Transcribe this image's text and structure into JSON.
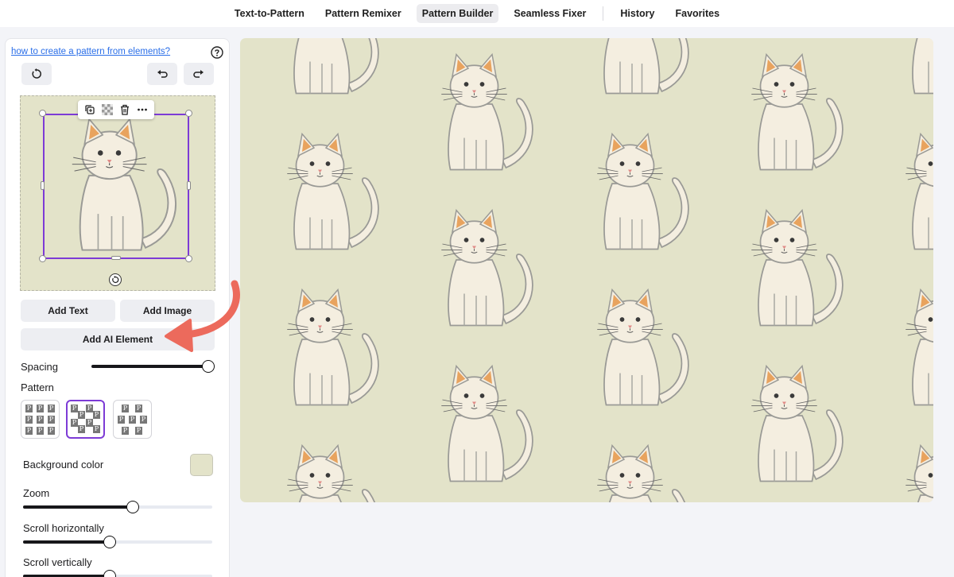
{
  "nav": {
    "tabs": [
      {
        "label": "Text-to-Pattern"
      },
      {
        "label": "Pattern Remixer"
      },
      {
        "label": "Pattern Builder"
      },
      {
        "label": "Seamless Fixer"
      },
      {
        "label": "History"
      },
      {
        "label": "Favorites"
      }
    ],
    "active_tab": "Pattern Builder"
  },
  "sidebar": {
    "help_link": "how to create a pattern from elements?",
    "buttons": {
      "add_text": "Add Text",
      "add_image": "Add Image",
      "add_ai_element": "Add AI Element"
    },
    "spacing": {
      "label": "Spacing",
      "value": 1.0
    },
    "pattern": {
      "label": "Pattern",
      "selected_index": 1
    },
    "background": {
      "label": "Background color",
      "value": "#e3e3c9"
    },
    "zoom": {
      "label": "Zoom",
      "value": 0.58
    },
    "scroll_h": {
      "label": "Scroll horizontally",
      "value": 0.46
    },
    "scroll_v": {
      "label": "Scroll vertically",
      "value": 0.46
    },
    "pattern_chip_letter": "P"
  },
  "colors": {
    "accent": "#7d3bd6",
    "arrow": "#ec6a5c",
    "canvas_bg": "#e3e3c9",
    "link": "#2a6ee8"
  },
  "icons": {
    "reset": "rotate-reset-icon",
    "undo": "undo-icon",
    "redo": "redo-icon",
    "help": "question-circle-icon",
    "duplicate": "duplicate-icon",
    "transparency": "checker-icon",
    "delete": "trash-icon",
    "more": "more-dots-icon",
    "rotate": "rotate-icon"
  }
}
